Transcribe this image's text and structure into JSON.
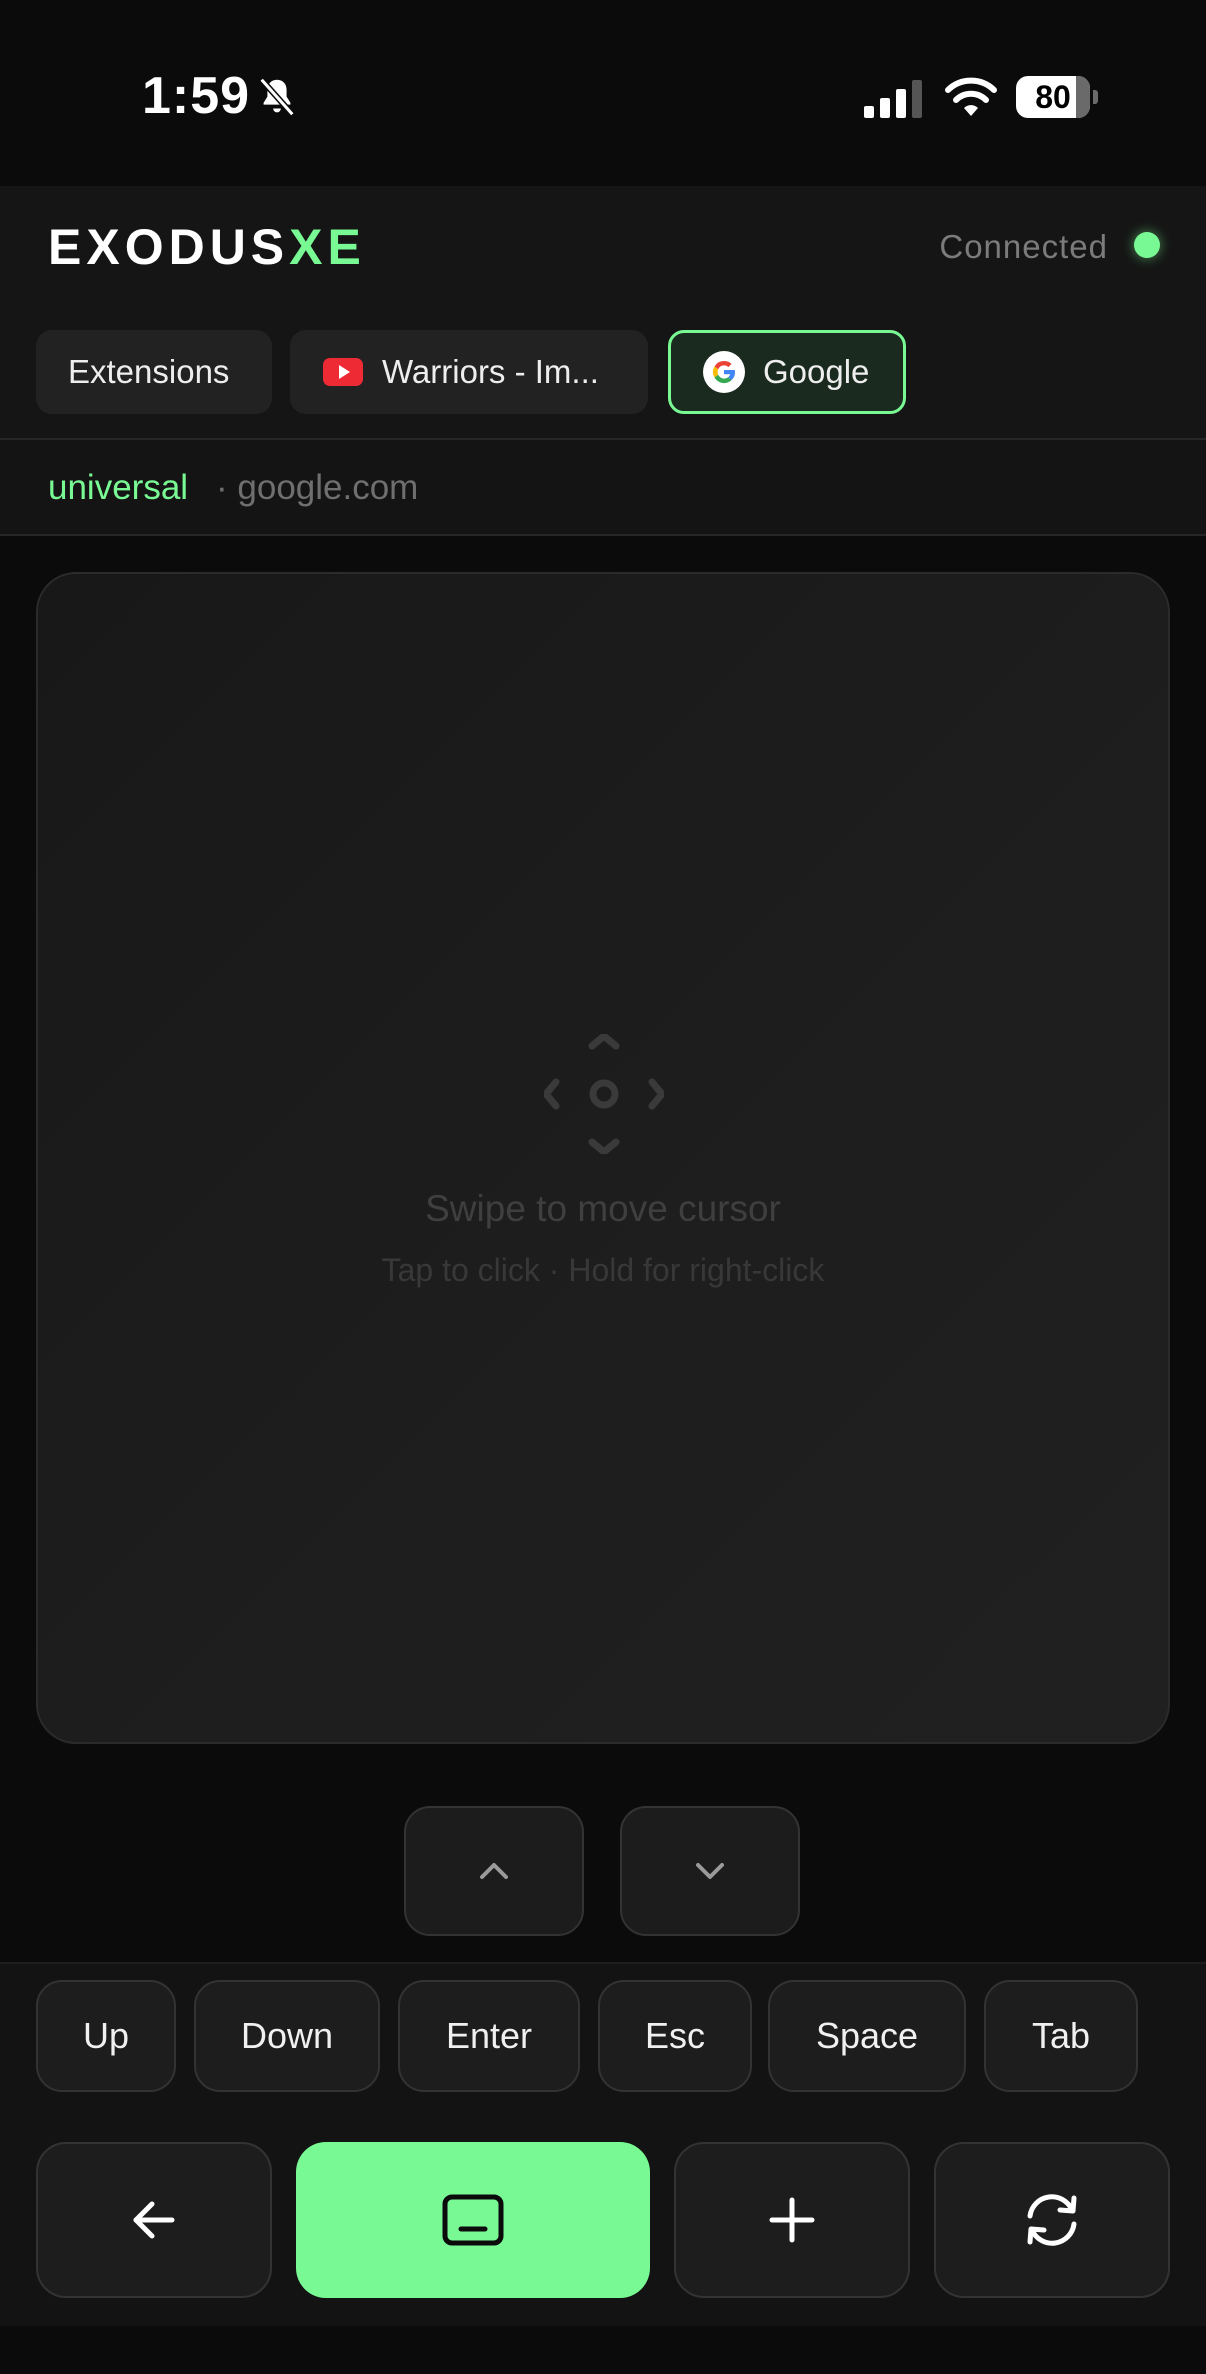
{
  "status_bar": {
    "time": "1:59",
    "battery_level": "80",
    "icons": [
      "bell-slash-icon",
      "signal-icon",
      "wifi-icon",
      "battery-icon"
    ]
  },
  "header": {
    "brand_main": "EXODUS",
    "brand_accent": "XE",
    "connection_status": "Connected",
    "accent_color": "#79f994"
  },
  "tabs": [
    {
      "label": "Extensions",
      "icon": null,
      "active": false
    },
    {
      "label": "Warriors - Im...",
      "icon": "youtube-icon",
      "active": false
    },
    {
      "label": "Google",
      "icon": "google-icon",
      "active": true
    }
  ],
  "domain_bar": {
    "mode": "universal",
    "separator": "·",
    "domain": "google.com"
  },
  "trackpad": {
    "icon": "move-cursor-icon",
    "title": "Swipe to move cursor",
    "subtitle": "Tap to click · Hold for right-click"
  },
  "scroll_buttons": {
    "up_icon": "chevron-up-icon",
    "down_icon": "chevron-down-icon"
  },
  "keys": [
    "Up",
    "Down",
    "Enter",
    "Esc",
    "Space",
    "Tab"
  ],
  "bottom_bar": {
    "back_icon": "arrow-left-icon",
    "keyboard_icon": "keyboard-toggle-icon",
    "add_icon": "plus-icon",
    "refresh_icon": "refresh-icon"
  }
}
